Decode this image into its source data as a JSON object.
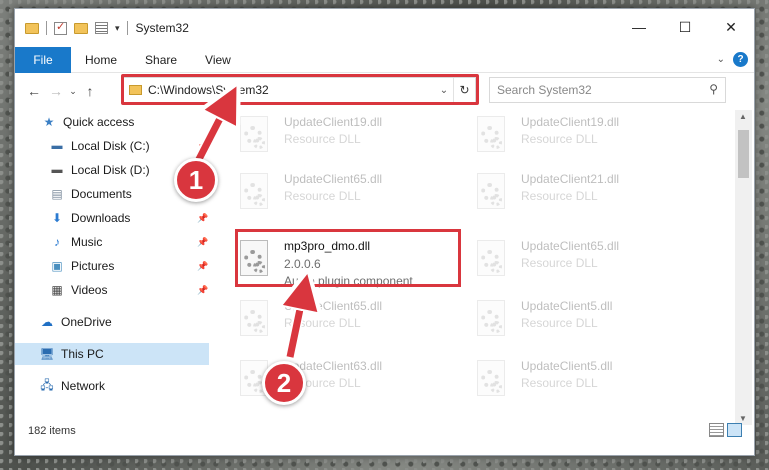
{
  "window": {
    "title": "System32"
  },
  "ribbon": {
    "tabs": [
      "File",
      "Home",
      "Share",
      "View"
    ]
  },
  "nav": {
    "address": "C:\\Windows\\System32",
    "search_placeholder": "Search System32"
  },
  "sidebar": {
    "items": [
      {
        "label": "Quick access",
        "icon": "star-icon",
        "pinned": false
      },
      {
        "label": "Local Disk (C:)",
        "icon": "drive-icon",
        "pinned": true
      },
      {
        "label": "Local Disk (D:)",
        "icon": "drive-icon",
        "pinned": false
      },
      {
        "label": "Documents",
        "icon": "documents-icon",
        "pinned": false
      },
      {
        "label": "Downloads",
        "icon": "download-icon",
        "pinned": true
      },
      {
        "label": "Music",
        "icon": "music-icon",
        "pinned": true
      },
      {
        "label": "Pictures",
        "icon": "pictures-icon",
        "pinned": true
      },
      {
        "label": "Videos",
        "icon": "videos-icon",
        "pinned": true
      },
      {
        "label": "OneDrive",
        "icon": "cloud-icon",
        "pinned": false
      },
      {
        "label": "This PC",
        "icon": "computer-icon",
        "pinned": false,
        "selected": true
      },
      {
        "label": "Network",
        "icon": "network-icon",
        "pinned": false
      }
    ]
  },
  "files": {
    "left": [
      {
        "name": "UpdateClient19.dll",
        "sub": "Resource DLL",
        "faded": true
      },
      {
        "name": "UpdateClient65.dll",
        "sub": "Resource DLL",
        "faded": true
      },
      {
        "name": "mp3pro_dmo.dll",
        "version": "2.0.0.6",
        "desc": "Audio plugin component",
        "faded": false
      },
      {
        "name": "UpdateClient65.dll",
        "sub": "Resource DLL",
        "faded": true
      },
      {
        "name": "UpdateClient63.dll",
        "sub": "Resource DLL",
        "faded": true
      }
    ],
    "right": [
      {
        "name": "UpdateClient19.dll",
        "sub": "Resource DLL",
        "faded": true
      },
      {
        "name": "UpdateClient21.dll",
        "sub": "Resource DLL",
        "faded": true
      },
      {
        "name": "UpdateClient65.dll",
        "sub": "Resource DLL",
        "faded": true
      },
      {
        "name": "UpdateClient5.dll",
        "sub": "Resource DLL",
        "faded": true
      },
      {
        "name": "UpdateClient5.dll",
        "sub": "Resource DLL",
        "faded": true
      }
    ]
  },
  "status": {
    "item_count": "182 items"
  },
  "callouts": [
    "1",
    "2"
  ],
  "colors": {
    "accent": "#1979ca",
    "highlight": "#d9363e",
    "selection": "#cce4f7"
  }
}
